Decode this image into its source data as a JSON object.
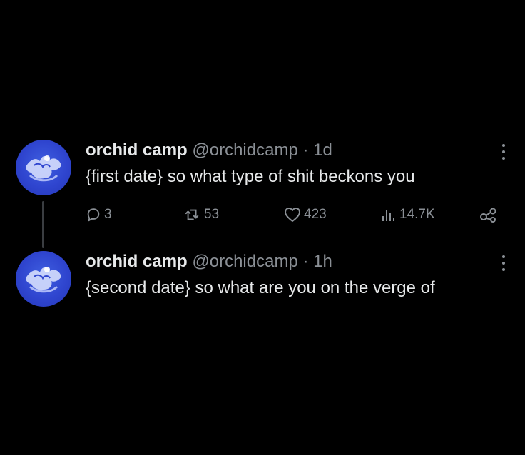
{
  "tweets": [
    {
      "author_name": "orchid camp",
      "handle": "@orchidcamp",
      "separator": "·",
      "time": "1d",
      "text": "{first date} so what type of shit beckons you",
      "replies": "3",
      "retweets": "53",
      "likes": "423",
      "views": "14.7K"
    },
    {
      "author_name": "orchid camp",
      "handle": "@orchidcamp",
      "separator": "·",
      "time": "1h",
      "text": "{second date} so what are you on the verge of"
    }
  ],
  "icons": {
    "reply": "speech-bubble-icon",
    "retweet": "retweet-arrows-icon",
    "like": "heart-icon",
    "views": "bar-chart-icon",
    "share": "share-nodes-icon",
    "more": "vertical-ellipsis-icon"
  },
  "colors": {
    "background": "#000000",
    "primary_text": "#e7e9ea",
    "secondary_text": "#8b9096",
    "avatar_blue": "#2f45cf",
    "thread_line": "#3a3d41"
  }
}
